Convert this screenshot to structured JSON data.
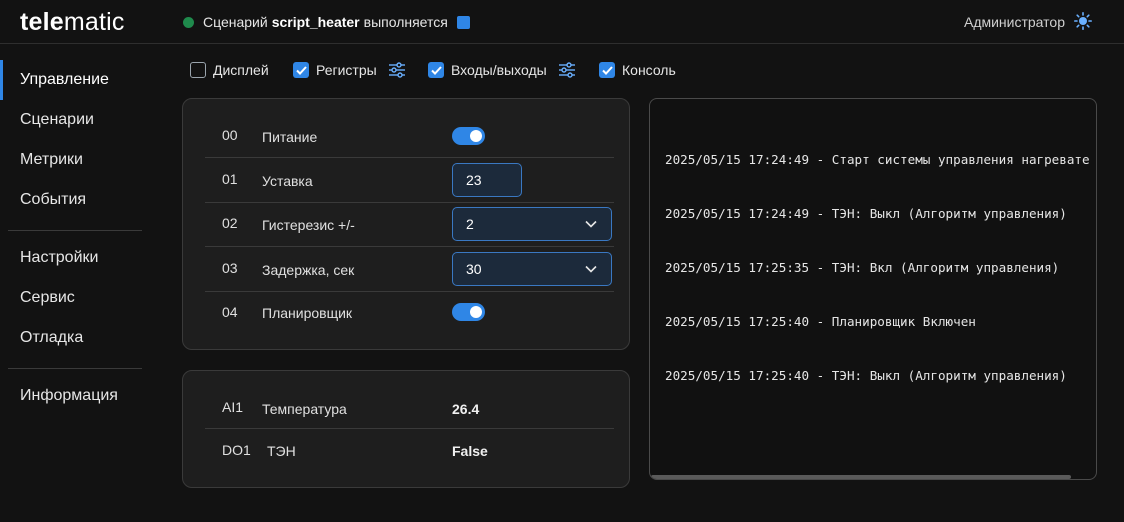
{
  "header": {
    "logo_bold": "tele",
    "logo_light": "matic",
    "status_prefix": "Сценарий",
    "script_name": "script_heater",
    "status_suffix": "выполняется",
    "user": "Администратор"
  },
  "sidebar": {
    "items": [
      {
        "label": "Управление"
      },
      {
        "label": "Сценарии"
      },
      {
        "label": "Метрики"
      },
      {
        "label": "События"
      },
      {
        "label": "Настройки"
      },
      {
        "label": "Сервис"
      },
      {
        "label": "Отладка"
      },
      {
        "label": "Информация"
      }
    ]
  },
  "toolbar": {
    "checkboxes": [
      {
        "label": "Дисплей",
        "checked": false
      },
      {
        "label": "Регистры",
        "checked": true
      },
      {
        "label": "Входы/выходы",
        "checked": true
      },
      {
        "label": "Консоль",
        "checked": true
      }
    ]
  },
  "registers": {
    "rows": [
      {
        "num": "00",
        "label": "Питание",
        "type": "toggle",
        "value": true
      },
      {
        "num": "01",
        "label": "Уставка",
        "type": "input",
        "value": "23"
      },
      {
        "num": "02",
        "label": "Гистерезис +/-",
        "type": "select",
        "value": "2"
      },
      {
        "num": "03",
        "label": "Задержка, сек",
        "type": "select",
        "value": "30"
      },
      {
        "num": "04",
        "label": "Планировщик",
        "type": "toggle",
        "value": true
      }
    ]
  },
  "io": {
    "rows": [
      {
        "num": "AI1",
        "label": "Температура",
        "value": "26.4"
      },
      {
        "num": "DO1",
        "label": "ТЭН",
        "value": "False"
      }
    ]
  },
  "console": {
    "lines": [
      "2025/05/15 17:24:49 - Старт системы управления нагревате",
      "2025/05/15 17:24:49 - ТЭН: Выкл (Алгоритм управления)",
      "2025/05/15 17:25:35 - ТЭН: Вкл (Алгоритм управления)",
      "2025/05/15 17:25:40 - Планировщик Включен",
      "2025/05/15 17:25:40 - ТЭН: Выкл (Алгоритм управления)"
    ]
  },
  "colors": {
    "accent": "#2f86e6",
    "status_ok": "#1f8a4c",
    "background": "#121212",
    "panel": "#1e1e1e"
  },
  "icons": {
    "status": "status-dot-icon",
    "stop": "stop-icon",
    "theme": "sun-icon",
    "tune": "sliders-icon",
    "check": "checkmark-icon",
    "dropdown": "chevron-down-icon"
  }
}
